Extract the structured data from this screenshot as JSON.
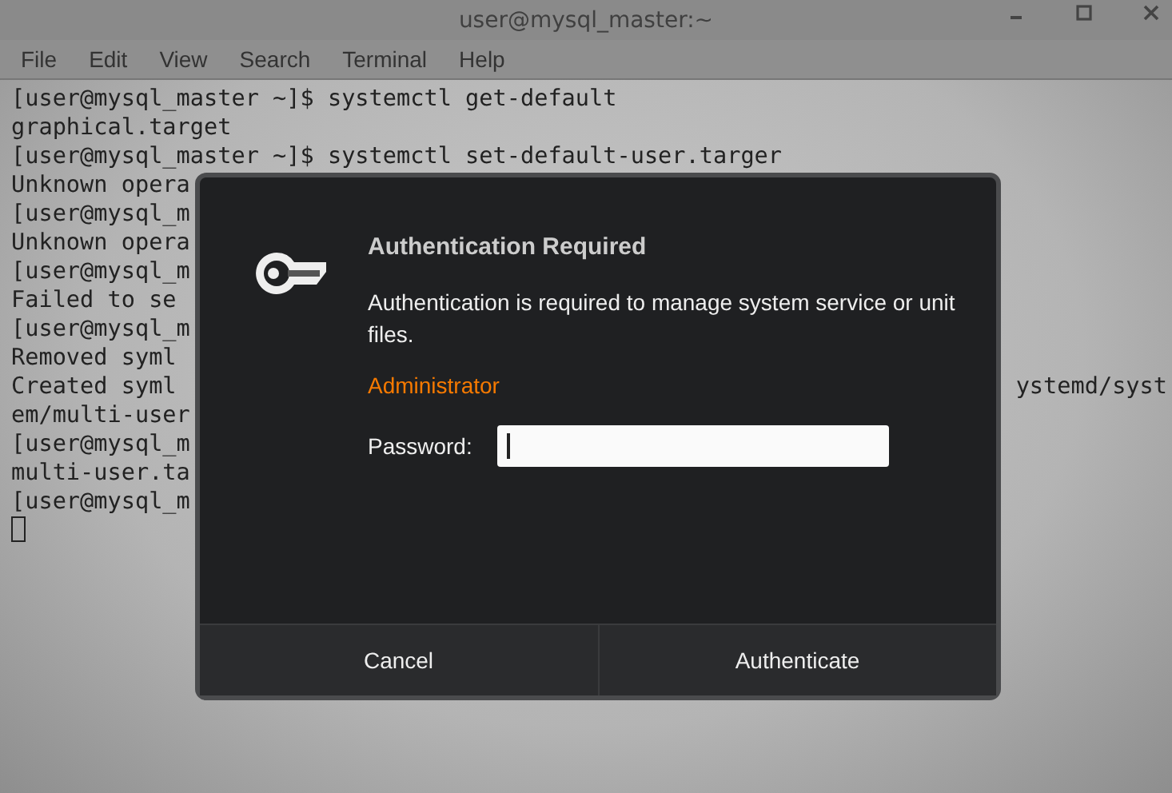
{
  "window": {
    "title": "user@mysql_master:~"
  },
  "menu": [
    "File",
    "Edit",
    "View",
    "Search",
    "Terminal",
    "Help"
  ],
  "terminal": {
    "lines": [
      {
        "text": "[user@mysql_master ~]$ systemctl get-default"
      },
      {
        "text": "graphical.target"
      },
      {
        "text": "[user@mysql_master ~]$ systemctl set-default-user.targer"
      },
      {
        "text": "Unknown opera"
      },
      {
        "text": "[user@mysql_m"
      },
      {
        "text": "Unknown opera"
      },
      {
        "text": "[user@mysql_m"
      },
      {
        "text": "Failed to se"
      },
      {
        "text": "[user@mysql_m"
      },
      {
        "text": "Removed syml"
      },
      {
        "text": "Created syml",
        "text_right": "ystemd/syst"
      },
      {
        "text": "em/multi-user"
      },
      {
        "text": "[user@mysql_m"
      },
      {
        "text": "multi-user.ta"
      },
      {
        "text": "[user@mysql_m"
      }
    ]
  },
  "dialog": {
    "title": "Authentication Required",
    "message": "Authentication is required to manage system service or unit files.",
    "user": "Administrator",
    "password_label": "Password:",
    "buttons": [
      "Cancel",
      "Authenticate"
    ]
  }
}
